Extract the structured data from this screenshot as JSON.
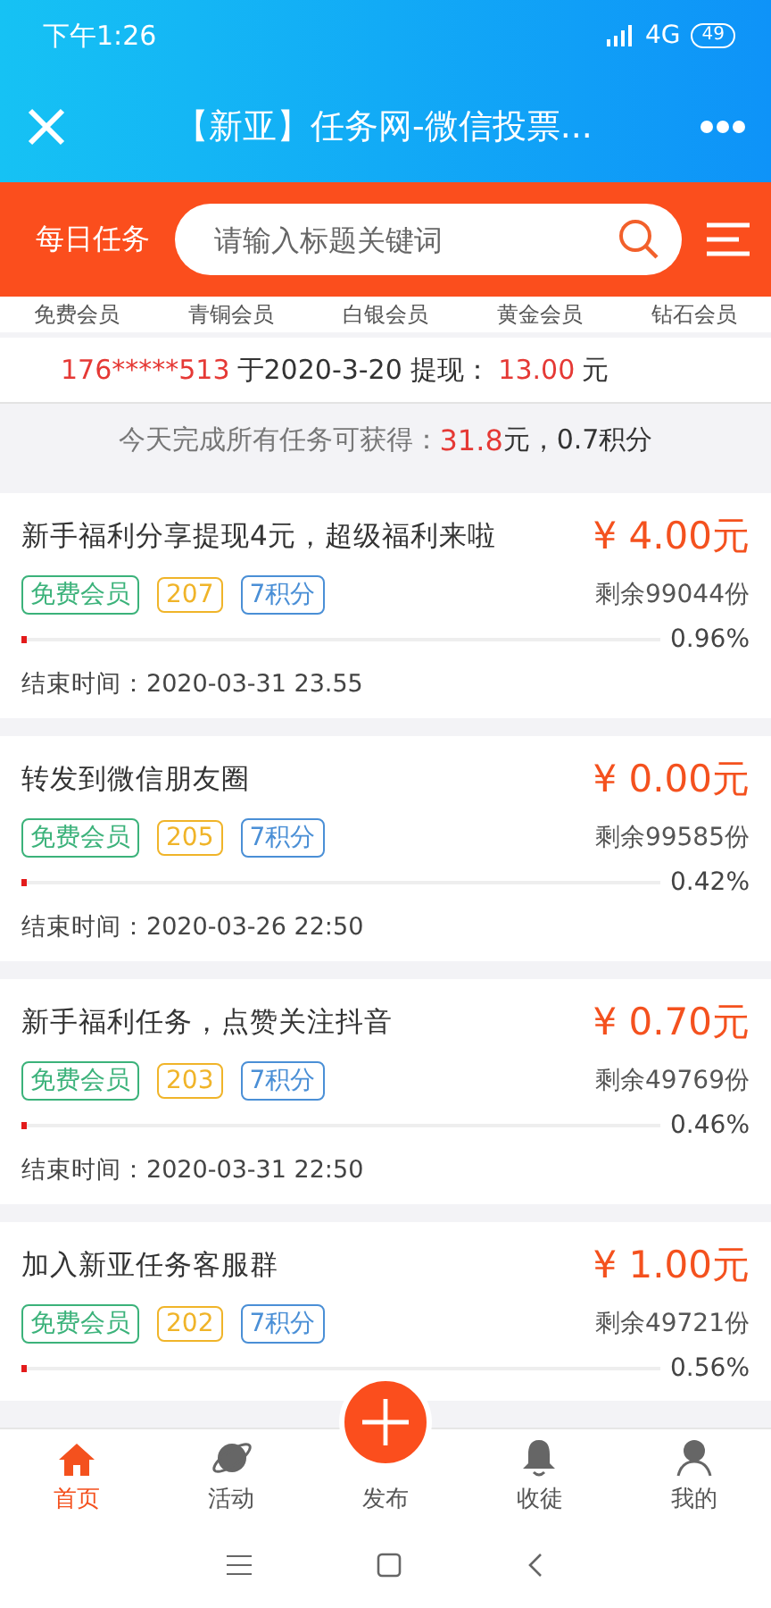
{
  "status_bar": {
    "time": "下午1:26",
    "network": "4G",
    "battery": "49"
  },
  "title_bar": {
    "title": "【新亚】任务网-微信投票..."
  },
  "search_bar": {
    "label": "每日任务",
    "placeholder": "请输入标题关键词"
  },
  "tiers": [
    "免费会员",
    "青铜会员",
    "白银会员",
    "黄金会员",
    "钻石会员"
  ],
  "notice": {
    "user": "176*****513",
    "text": "于2020-3-20 提现：",
    "amount": "13.00",
    "unit": "元"
  },
  "summary": {
    "text": "今天完成所有任务可获得：",
    "money": "31.8",
    "rest": "元，0.7积分"
  },
  "tasks": [
    {
      "title": "新手福利分享提现4元，超级福利来啦",
      "price": "¥ 4.00元",
      "tags": [
        {
          "label": "免费会员",
          "color": "#3bb27a"
        },
        {
          "label": "207",
          "color": "#f0b429"
        },
        {
          "label": "7积分",
          "color": "#4a8fd6"
        }
      ],
      "remaining": "剩余99044份",
      "level": 0.0096,
      "percent": "0.96%",
      "end_time": "结束时间：2020-03-31 23.55"
    },
    {
      "title": "转发到微信朋友圈",
      "price": "¥ 0.00元",
      "tags": [
        {
          "label": "免费会员",
          "color": "#3bb27a"
        },
        {
          "label": "205",
          "color": "#f0b429"
        },
        {
          "label": "7积分",
          "color": "#4a8fd6"
        }
      ],
      "remaining": "剩余99585份",
      "level": 0.0042,
      "percent": "0.42%",
      "end_time": "结束时间：2020-03-26 22:50"
    },
    {
      "title": "新手福利任务，点赞关注抖音",
      "price": "¥ 0.70元",
      "tags": [
        {
          "label": "免费会员",
          "color": "#3bb27a"
        },
        {
          "label": "203",
          "color": "#f0b429"
        },
        {
          "label": "7积分",
          "color": "#4a8fd6"
        }
      ],
      "remaining": "剩余49769份",
      "level": 0.0046,
      "percent": "0.46%",
      "end_time": "结束时间：2020-03-31 22:50"
    },
    {
      "title": "加入新亚任务客服群",
      "price": "¥ 1.00元",
      "tags": [
        {
          "label": "免费会员",
          "color": "#3bb27a"
        },
        {
          "label": "202",
          "color": "#f0b429"
        },
        {
          "label": "7积分",
          "color": "#4a8fd6"
        }
      ],
      "remaining": "剩余49721份",
      "level": 0.0056,
      "percent": "0.56%"
    }
  ],
  "bottom_nav": [
    {
      "label": "首页",
      "selected": true
    },
    {
      "label": "活动",
      "selected": false
    },
    {
      "label": "发布",
      "selected": false
    },
    {
      "label": "收徒",
      "selected": false
    },
    {
      "label": "我的",
      "selected": false
    }
  ]
}
